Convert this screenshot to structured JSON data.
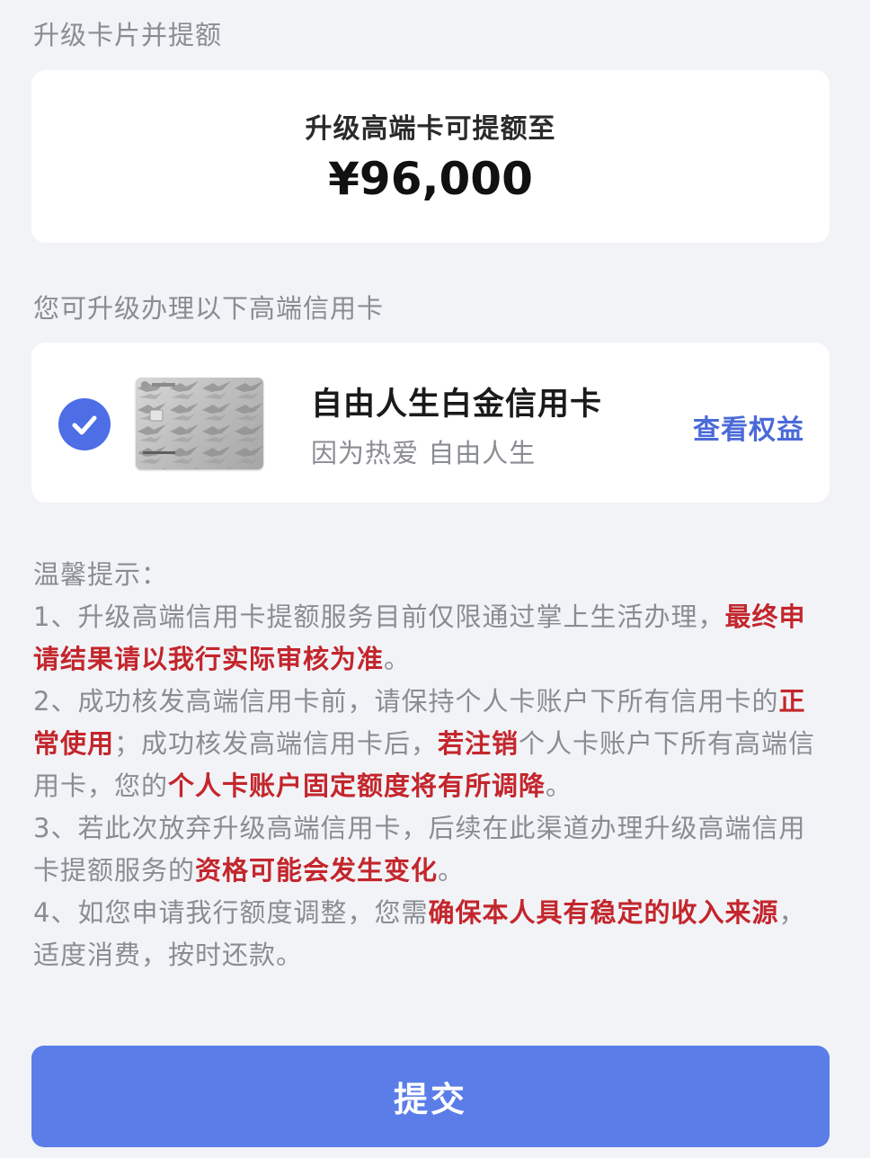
{
  "sections": {
    "upgrade_title": "升级卡片并提额",
    "cards_title": "您可升级办理以下高端信用卡"
  },
  "amount": {
    "label": "升级高端卡可提额至",
    "value": "¥96,000"
  },
  "card": {
    "name": "自由人生白金信用卡",
    "slogan": "因为热爱 自由人生",
    "view_benefits": "查看权益",
    "selected": true,
    "image_icon": "credit-card-image",
    "check_icon": "check-circle-icon"
  },
  "tips": {
    "heading": "温馨提示：",
    "items": [
      [
        {
          "text": "1、升级高端信用卡提额服务目前仅限通过掌上生活办理，",
          "highlight": false
        },
        {
          "text": "最终申请结果请以我行实际审核为准",
          "highlight": true
        },
        {
          "text": "。",
          "highlight": false
        }
      ],
      [
        {
          "text": "2、成功核发高端信用卡前，请保持个人卡账户下所有信用卡的",
          "highlight": false
        },
        {
          "text": "正常使用",
          "highlight": true
        },
        {
          "text": "；成功核发高端信用卡后，",
          "highlight": false
        },
        {
          "text": "若注销",
          "highlight": true
        },
        {
          "text": "个人卡账户下所有高端信用卡，您的",
          "highlight": false
        },
        {
          "text": "个人卡账户固定额度将有所调降",
          "highlight": true
        },
        {
          "text": "。",
          "highlight": false
        }
      ],
      [
        {
          "text": "3、若此次放弃升级高端信用卡，后续在此渠道办理升级高端信用卡提额服务的",
          "highlight": false
        },
        {
          "text": "资格可能会发生变化",
          "highlight": true
        },
        {
          "text": "。",
          "highlight": false
        }
      ],
      [
        {
          "text": "4、如您申请我行额度调整，您需",
          "highlight": false
        },
        {
          "text": "确保本人具有稳定的收入来源",
          "highlight": true
        },
        {
          "text": "，适度消费，按时还款。",
          "highlight": false
        }
      ]
    ]
  },
  "submit": {
    "label": "提交"
  },
  "colors": {
    "accent": "#5b7de8",
    "link": "#4a6ad8",
    "highlight": "#c3262c",
    "muted": "#8a8c93",
    "background": "#f2f3f7"
  }
}
